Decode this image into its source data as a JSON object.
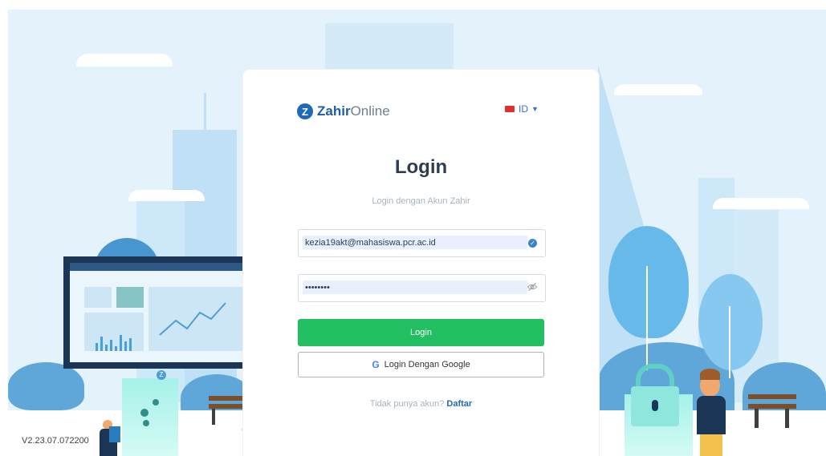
{
  "brand": {
    "name": "Zahir",
    "suffix": "Online",
    "logo_letter": "Z"
  },
  "language": {
    "code": "ID",
    "flag_color": "#e03131"
  },
  "login": {
    "title": "Login",
    "subtitle": "Login dengan Akun Zahir",
    "email_value": "kezia19akt@mahasiswa.pcr.ac.id",
    "password_value": "••••••••",
    "login_button": "Login",
    "google_button": "Login Dengan Google",
    "signup_prompt": "Tidak punya akun?",
    "signup_link": "Daftar"
  },
  "footer": {
    "version": "V2.23.07.072200"
  },
  "colors": {
    "primary": "#21bf62",
    "brand": "#1e69b8",
    "background": "#e3f2fb"
  },
  "icons": {
    "brand": "zahir-logo-icon",
    "language": "flag-icon",
    "email_status": "check-circle-icon",
    "password_toggle": "eye-off-icon",
    "google": "google-icon"
  }
}
